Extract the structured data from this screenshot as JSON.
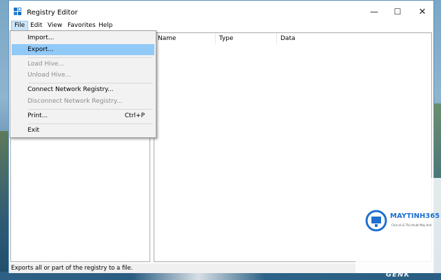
{
  "window": {
    "title": "Registry Editor"
  },
  "titlebar_buttons": {
    "minimize": "—",
    "maximize": "☐",
    "close": "✕"
  },
  "menubar": [
    "File",
    "Edit",
    "View",
    "Favorites",
    "Help"
  ],
  "list_columns": [
    "Name",
    "Type",
    "Data"
  ],
  "file_menu": {
    "import": "Import...",
    "export": "Export...",
    "load_hive": "Load Hive...",
    "unload_hive": "Unload Hive...",
    "connect_network": "Connect Network Registry...",
    "disconnect_network": "Disconnect Network Registry...",
    "print": "Print...",
    "print_shortcut": "Ctrl+P",
    "exit": "Exit"
  },
  "status_bar": "Exports all or part of the registry to a file.",
  "watermark": {
    "brand": "MAYTINH365",
    "sub": "Chia sẻ & Thủ thuật Máy tính",
    "site": "GENK"
  },
  "colors": {
    "menu_highlight": "#91c9f7",
    "file_menu_active": "#cce4f7",
    "brand": "#1e6fd0"
  }
}
